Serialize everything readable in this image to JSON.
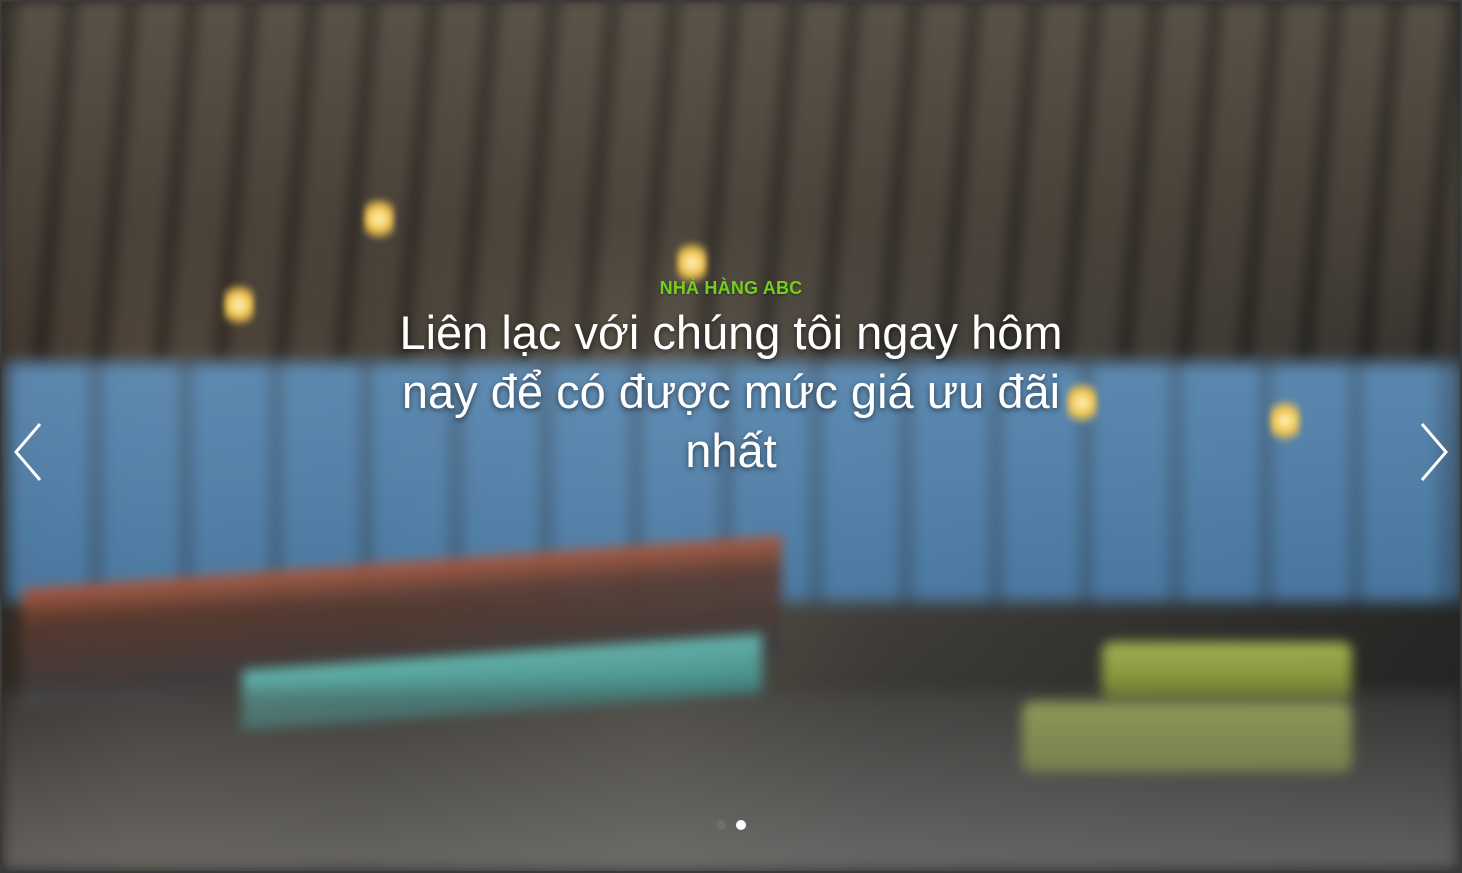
{
  "hero": {
    "kicker": "NHÀ HÀNG ABC",
    "headline": "Liên lạc với chúng tôi ngay hôm nay để có được mức giá ưu đãi nhất"
  },
  "controls": {
    "prev_icon": "chevron-left-icon",
    "next_icon": "chevron-right-icon",
    "dots_count": 2,
    "active_dot_index": 1
  },
  "colors": {
    "kicker": "#74d11b",
    "headline": "#ffffff",
    "dot_active": "#ffffff",
    "dot_inactive": "#787878"
  }
}
